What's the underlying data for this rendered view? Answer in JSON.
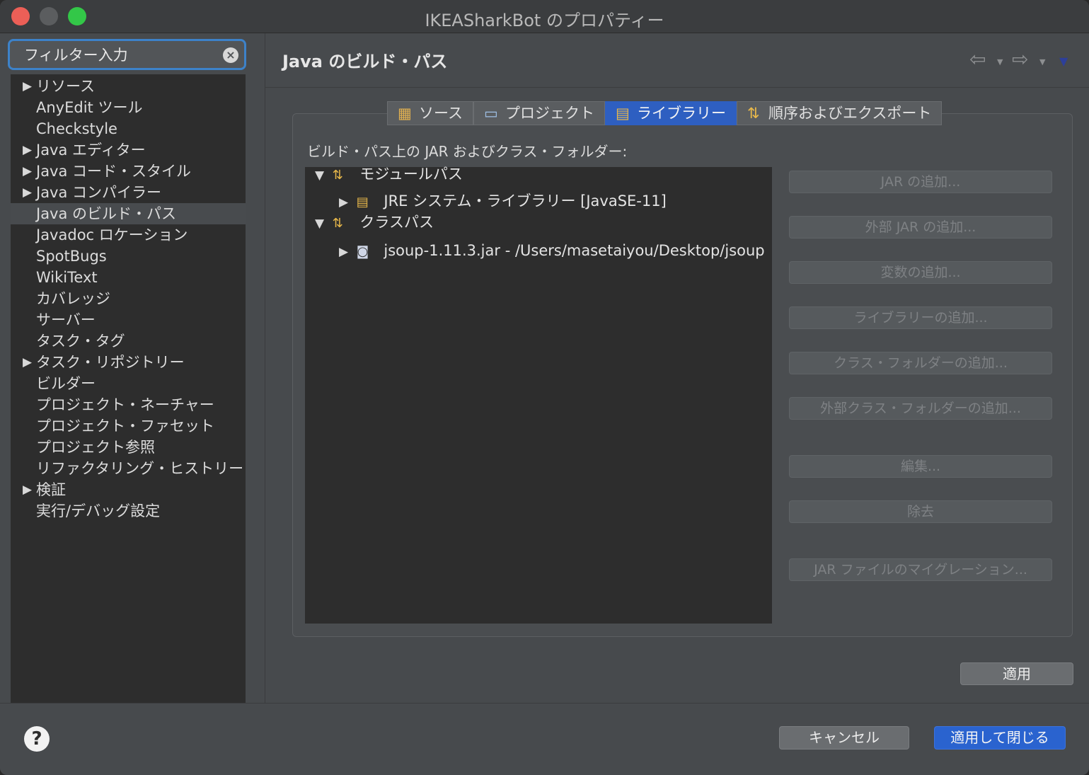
{
  "window": {
    "title": "IKEASharkBot のプロパティー"
  },
  "filter": {
    "placeholder": "フィルター入力",
    "clear_icon": "clear-circle-icon"
  },
  "sidebar": {
    "items": [
      {
        "label": "リソース",
        "expandable": true,
        "selected": false
      },
      {
        "label": "AnyEdit ツール",
        "expandable": false,
        "selected": false
      },
      {
        "label": "Checkstyle",
        "expandable": false,
        "selected": false
      },
      {
        "label": "Java エディター",
        "expandable": true,
        "selected": false
      },
      {
        "label": "Java コード・スタイル",
        "expandable": true,
        "selected": false
      },
      {
        "label": "Java コンパイラー",
        "expandable": true,
        "selected": false
      },
      {
        "label": "Java のビルド・パス",
        "expandable": false,
        "selected": true
      },
      {
        "label": "Javadoc ロケーション",
        "expandable": false,
        "selected": false
      },
      {
        "label": "SpotBugs",
        "expandable": false,
        "selected": false
      },
      {
        "label": "WikiText",
        "expandable": false,
        "selected": false
      },
      {
        "label": "カバレッジ",
        "expandable": false,
        "selected": false
      },
      {
        "label": "サーバー",
        "expandable": false,
        "selected": false
      },
      {
        "label": "タスク・タグ",
        "expandable": false,
        "selected": false
      },
      {
        "label": "タスク・リポジトリー",
        "expandable": true,
        "selected": false
      },
      {
        "label": "ビルダー",
        "expandable": false,
        "selected": false
      },
      {
        "label": "プロジェクト・ネーチャー",
        "expandable": false,
        "selected": false
      },
      {
        "label": "プロジェクト・ファセット",
        "expandable": false,
        "selected": false
      },
      {
        "label": "プロジェクト参照",
        "expandable": false,
        "selected": false
      },
      {
        "label": "リファクタリング・ヒストリー",
        "expandable": false,
        "selected": false
      },
      {
        "label": "検証",
        "expandable": true,
        "selected": false
      },
      {
        "label": "実行/デバッグ設定",
        "expandable": false,
        "selected": false
      }
    ]
  },
  "page": {
    "title": "Java のビルド・パス",
    "nav_back_icon": "back-arrow-icon",
    "nav_forward_icon": "forward-arrow-icon",
    "view_menu_icon": "view-menu-icon"
  },
  "tabs": [
    {
      "label": "ソース",
      "icon": "source-folder-icon",
      "active": false
    },
    {
      "label": "プロジェクト",
      "icon": "project-folder-icon",
      "active": false
    },
    {
      "label": "ライブラリー",
      "icon": "library-icon",
      "active": true
    },
    {
      "label": "順序およびエクスポート",
      "icon": "order-export-icon",
      "active": false
    }
  ],
  "classpath": {
    "label": "ビルド・パス上の JAR およびクラス・フォルダー:",
    "rows": [
      {
        "label": "モジュールパス",
        "level": 0,
        "expanded": true,
        "icon": "module-path-icon"
      },
      {
        "label": "JRE システム・ライブラリー [JavaSE-11]",
        "level": 1,
        "expanded": false,
        "icon": "jre-library-icon"
      },
      {
        "label": "クラスパス",
        "level": 0,
        "expanded": true,
        "icon": "classpath-icon"
      },
      {
        "label": "jsoup-1.11.3.jar - /Users/masetaiyou/Desktop/jsoup",
        "level": 1,
        "expanded": false,
        "icon": "jar-file-icon"
      }
    ]
  },
  "buttons": {
    "add_jar": "JAR の追加...",
    "add_external_jar": "外部 JAR の追加...",
    "add_variable": "変数の追加...",
    "add_library": "ライブラリーの追加...",
    "add_class_folder": "クラス・フォルダーの追加...",
    "add_external_class_folder": "外部クラス・フォルダーの追加...",
    "edit": "編集...",
    "remove": "除去",
    "migrate_jar": "JAR ファイルのマイグレーション...",
    "apply": "適用",
    "cancel": "キャンセル",
    "apply_and_close": "適用して閉じる"
  },
  "colors": {
    "accent": "#2a63cf",
    "close": "#ec5f57",
    "maximize": "#33c748"
  }
}
